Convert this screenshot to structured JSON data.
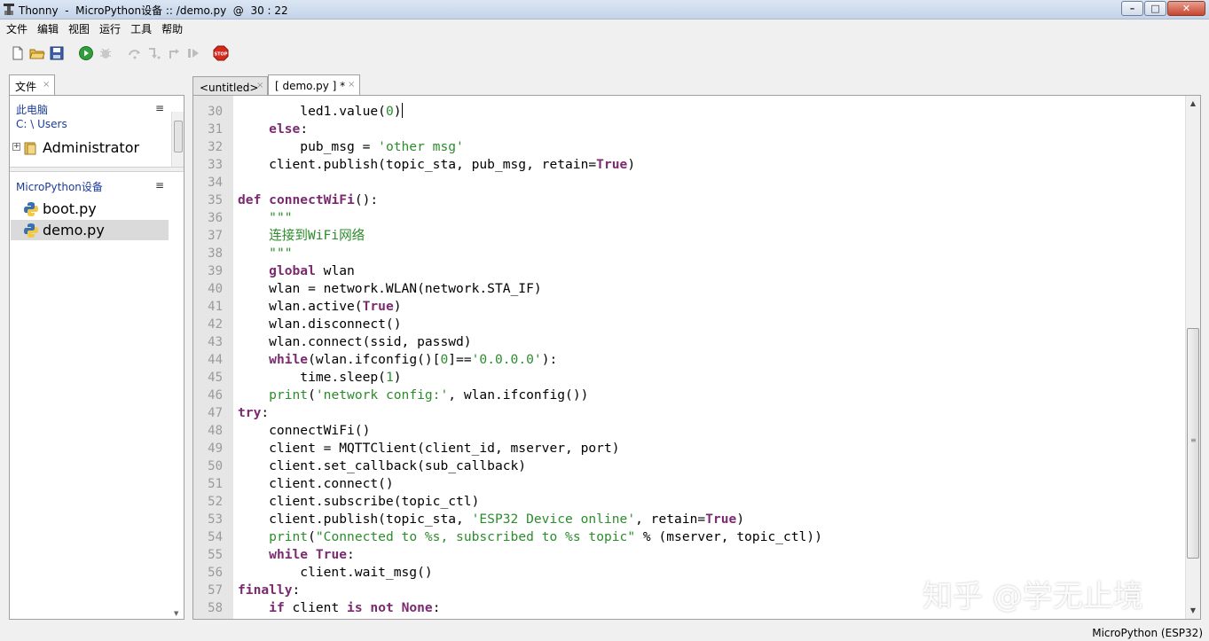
{
  "window": {
    "title": "Thonny  -  MicroPython设备 :: /demo.py  @  30 : 22",
    "minimize": "–",
    "maximize": "□",
    "close": "✕"
  },
  "menu": [
    "文件",
    "编辑",
    "视图",
    "运行",
    "工具",
    "帮助"
  ],
  "toolbar": {
    "icons": [
      "new-file-icon",
      "open-folder-icon",
      "save-icon",
      "run-icon",
      "debug-icon",
      "step-over-icon",
      "step-into-icon",
      "step-out-icon",
      "resume-icon",
      "stop-icon"
    ],
    "stop_label": "STOP",
    "colors": {
      "run": "#2f9e3b",
      "stop": "#d42a1e"
    }
  },
  "files_panel": {
    "tab_label": "文件",
    "tab_close": "×",
    "local": {
      "title": "此电脑",
      "path": "C: \\ Users",
      "menu": "≡",
      "items": [
        {
          "name": "Administrator",
          "expander": "+"
        }
      ]
    },
    "device": {
      "title": "MicroPython设备",
      "menu": "≡",
      "items": [
        {
          "name": "boot.py"
        },
        {
          "name": "demo.py"
        }
      ]
    }
  },
  "editor_tabs": [
    {
      "label": "<untitled>",
      "close": "×"
    },
    {
      "label": "[ demo.py ] *",
      "close": "×"
    }
  ],
  "code_lines": [
    {
      "n": "30",
      "html": "        led1.value(<span class=\"num\">0</span>)<span class=\"cursor\"></span>"
    },
    {
      "n": "31",
      "html": "    <span class=\"kw\">else</span>:"
    },
    {
      "n": "32",
      "html": "        pub_msg = <span class=\"str\">'other msg'</span>"
    },
    {
      "n": "33",
      "html": "    client.publish(topic_sta, pub_msg, retain=<span class=\"kw\">True</span>)"
    },
    {
      "n": "34",
      "html": ""
    },
    {
      "n": "35",
      "html": "<span class=\"kw\">def</span> <span class=\"kw\">connectWiFi</span>():"
    },
    {
      "n": "36",
      "html": "    <span class=\"str\">\"\"\"</span>"
    },
    {
      "n": "37",
      "html": "    <span class=\"str\">连接到WiFi网络</span>"
    },
    {
      "n": "38",
      "html": "    <span class=\"str\">\"\"\"</span>"
    },
    {
      "n": "39",
      "html": "    <span class=\"kw\">global</span> wlan"
    },
    {
      "n": "40",
      "html": "    wlan = network.WLAN(network.STA_IF)"
    },
    {
      "n": "41",
      "html": "    wlan.active(<span class=\"kw\">True</span>)"
    },
    {
      "n": "42",
      "html": "    wlan.disconnect()"
    },
    {
      "n": "43",
      "html": "    wlan.connect(ssid, passwd)"
    },
    {
      "n": "44",
      "html": "    <span class=\"kw\">while</span>(wlan.ifconfig()[<span class=\"num\">0</span>]==<span class=\"str\">'0.0.0.0'</span>):"
    },
    {
      "n": "45",
      "html": "        time.sleep(<span class=\"num\">1</span>)"
    },
    {
      "n": "46",
      "html": "    <span class=\"str\">print</span>(<span class=\"str\">'network config:'</span>, wlan.ifconfig())"
    },
    {
      "n": "47",
      "html": "<span class=\"kw\">try</span>:"
    },
    {
      "n": "48",
      "html": "    connectWiFi()"
    },
    {
      "n": "49",
      "html": "    client = MQTTClient(client_id, mserver, port)"
    },
    {
      "n": "50",
      "html": "    client.set_callback(sub_callback)"
    },
    {
      "n": "51",
      "html": "    client.connect()"
    },
    {
      "n": "52",
      "html": "    client.subscribe(topic_ctl)"
    },
    {
      "n": "53",
      "html": "    client.publish(topic_sta, <span class=\"str\">'ESP32 Device online'</span>, retain=<span class=\"kw\">True</span>)"
    },
    {
      "n": "54",
      "html": "    <span class=\"str\">print</span>(<span class=\"str\">\"Connected to %s, subscribed to %s topic\"</span> % (mserver, topic_ctl))"
    },
    {
      "n": "55",
      "html": "    <span class=\"kw\">while</span> <span class=\"kw\">True</span>:"
    },
    {
      "n": "56",
      "html": "        client.wait_msg()"
    },
    {
      "n": "57",
      "html": "<span class=\"kw\">finally</span>:"
    },
    {
      "n": "58",
      "html": "    <span class=\"kw\">if</span> client <span class=\"kw\">is</span> <span class=\"kw\">not</span> <span class=\"kw\">None</span>:"
    }
  ],
  "scrollbar": {
    "up": "▲",
    "down": "▼",
    "grip": "≡",
    "position": 0.45,
    "visible_fraction": 0.44
  },
  "watermark": "知乎 @学无止境",
  "status": {
    "interpreter": "MicroPython (ESP32)"
  },
  "colors": {
    "keyword": "#7b2a70",
    "string": "#2c8c2c",
    "gutter": "#e6e6e6",
    "selection": "#dadada",
    "panel_title": "#1a3c9a"
  }
}
